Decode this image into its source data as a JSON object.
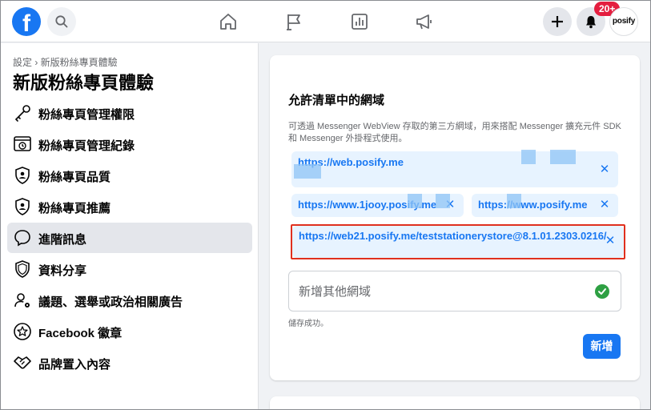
{
  "header": {
    "logo_letter": "f",
    "notification_count": "20+",
    "avatar_text": "posify"
  },
  "sidebar": {
    "breadcrumb": "設定 › 新版粉絲專頁體驗",
    "title": "新版粉絲專頁體驗",
    "items": [
      {
        "label": "粉絲專頁管理權限",
        "icon": "key-icon"
      },
      {
        "label": "粉絲專頁管理紀錄",
        "icon": "history-icon"
      },
      {
        "label": "粉絲專頁品質",
        "icon": "shield-check-icon"
      },
      {
        "label": "粉絲專頁推薦",
        "icon": "shield-check-icon"
      },
      {
        "label": "進階訊息",
        "icon": "speech-bubble-icon",
        "active": true
      },
      {
        "label": "資料分享",
        "icon": "shield-icon"
      },
      {
        "label": "議題、選舉或政治相關廣告",
        "icon": "user-gear-icon"
      },
      {
        "label": "Facebook 徽章",
        "icon": "star-badge-icon"
      },
      {
        "label": "品牌置入內容",
        "icon": "handshake-icon"
      }
    ]
  },
  "main": {
    "section_title": "允許清單中的網域",
    "description": "可透過 Messenger WebView 存取的第三方網域，用來搭配 Messenger 擴充元件 SDK 和 Messenger 外掛程式使用。",
    "domains": [
      "https://web.posify.me",
      "https://www.1jooy.posify.me",
      "https://www.posify.me",
      "https://web21.posify.me/teststationerystore@8.1.01.2303.0216/"
    ],
    "input_placeholder": "新增其他網域",
    "status": "儲存成功。",
    "add_button": "新增"
  },
  "colors": {
    "accent": "#1877f2",
    "chip_bg": "#e7f3ff",
    "highlight_border": "#e0301e",
    "success": "#2ea043",
    "badge": "#e41e3f"
  }
}
